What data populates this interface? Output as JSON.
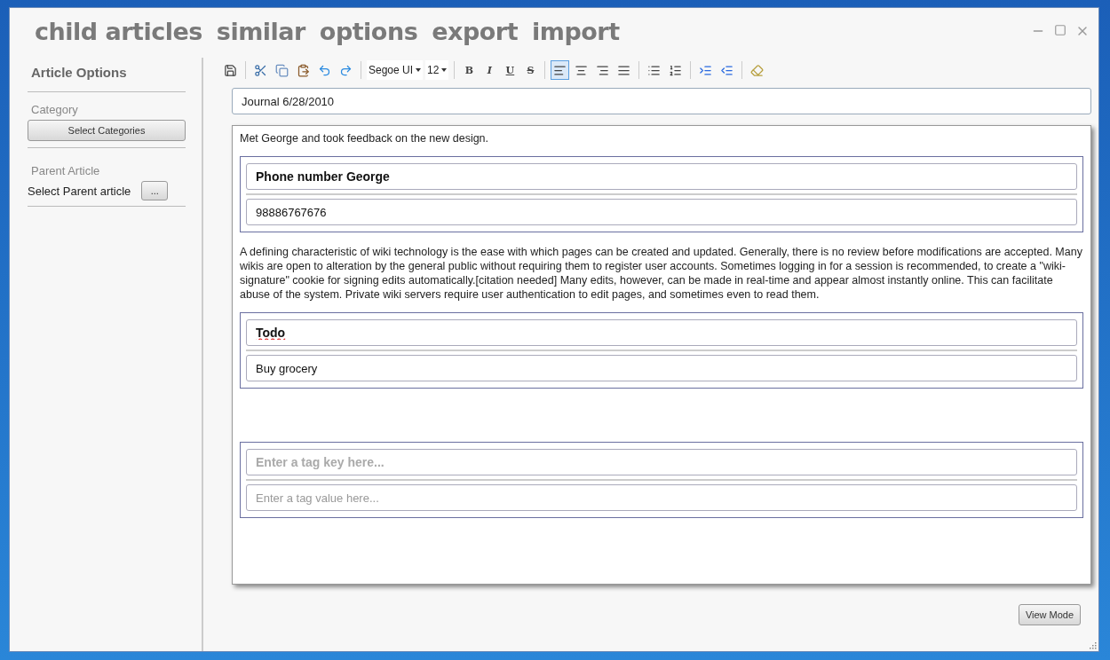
{
  "nav": [
    {
      "label": "child articles"
    },
    {
      "label": "similar"
    },
    {
      "label": "options"
    },
    {
      "label": "export"
    },
    {
      "label": "import"
    }
  ],
  "sidebar": {
    "title": "Article Options",
    "category_label": "Category",
    "category_button": "Select Categories",
    "parent_label": "Parent Article",
    "parent_text": "Select Parent article",
    "parent_button": "..."
  },
  "toolbar": {
    "font": "Segoe UI",
    "size": "12",
    "format_buttons": [
      {
        "kind": "bold",
        "label": "B"
      },
      {
        "kind": "italic",
        "label": "I"
      },
      {
        "kind": "underline",
        "label": "U"
      },
      {
        "kind": "strike",
        "label": "S"
      }
    ],
    "alignments": [
      {
        "kind": "left",
        "selected": true
      },
      {
        "kind": "center",
        "selected": false
      },
      {
        "kind": "right",
        "selected": false
      },
      {
        "kind": "justify",
        "selected": false
      }
    ]
  },
  "title_field": {
    "value": "Journal 6/28/2010"
  },
  "blocks": [
    {
      "kind": "paragraph",
      "text": "Met George and took feedback on the new design."
    },
    {
      "kind": "tag",
      "key": "Phone number George",
      "value": "98886767676",
      "misspelled": false
    },
    {
      "kind": "paragraph",
      "text": "A defining characteristic of wiki technology is the ease with which pages can be created and updated. Generally, there is no review before modifications are accepted. Many wikis are open to alteration by the general public without requiring them to register user accounts. Sometimes logging in for a session is recommended, to create a \"wiki-signature\" cookie for signing edits automatically.[citation needed] Many edits, however, can be made in real-time and appear almost instantly online. This can facilitate abuse of the system. Private wiki servers require user authentication to edit pages, and sometimes even to read them."
    },
    {
      "kind": "tag",
      "key": "Todo",
      "value": "Buy grocery",
      "misspelled": true
    },
    {
      "kind": "spacer"
    },
    {
      "kind": "tag",
      "key_placeholder": "Enter a tag key here...",
      "value_placeholder": "Enter a tag value here...",
      "misspelled": false
    }
  ],
  "view_button": "View Mode"
}
